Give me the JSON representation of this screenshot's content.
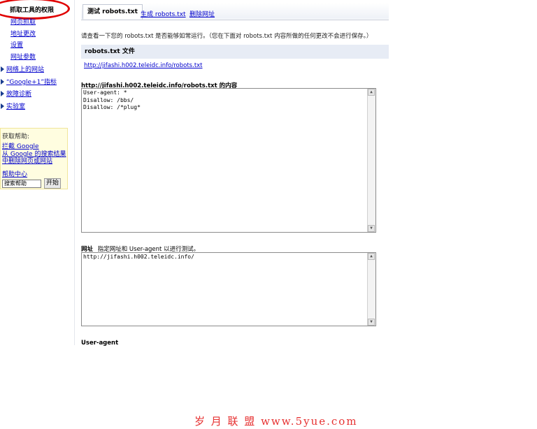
{
  "sidebar": {
    "active_item": "抓取工具的权限",
    "sub_items": [
      "网页抓取",
      "地址更改",
      "设置",
      "网址参数"
    ],
    "groups": [
      "网络上的网站",
      "“Google+1”指标",
      "故障诊断",
      "实验室"
    ],
    "help": {
      "title": "获取帮助:",
      "link1": "拦截 Google",
      "link2": "从 Google 的搜索结果中删除网页或网站",
      "link3": "帮助中心",
      "search_placeholder": "搜索帮助",
      "go_label": "开始"
    }
  },
  "tabs": [
    "测试 robots.txt",
    "生成 robots.txt",
    "删除网址"
  ],
  "intro": "请查看一下您的 robots.txt 是否能够如常运行。（您在下面对 robots.txt 内容所做的任何更改不会进行保存。）",
  "robots_section": {
    "title": "robots.txt 文件",
    "url": "http://jifashi.h002.teleidc.info/robots.txt"
  },
  "content_label": "http://jifashi.h002.teleidc.info/robots.txt 的内容",
  "robots_content": "User-agent: *\nDisallow: /bbs/\nDisallow: /*plug*",
  "url_field": {
    "label": "网址",
    "hint": "指定网址和 User-agent 以进行测试。",
    "value": "http://jifashi.h002.teleidc.info/"
  },
  "user_agent_label": "User-agent",
  "watermark": "岁 月 联 盟  www.5yue.com",
  "colors": {
    "annotation": "#e00000",
    "link": "#0000cc",
    "section_bg": "#e7ecf5",
    "watermark": "#e63030"
  }
}
